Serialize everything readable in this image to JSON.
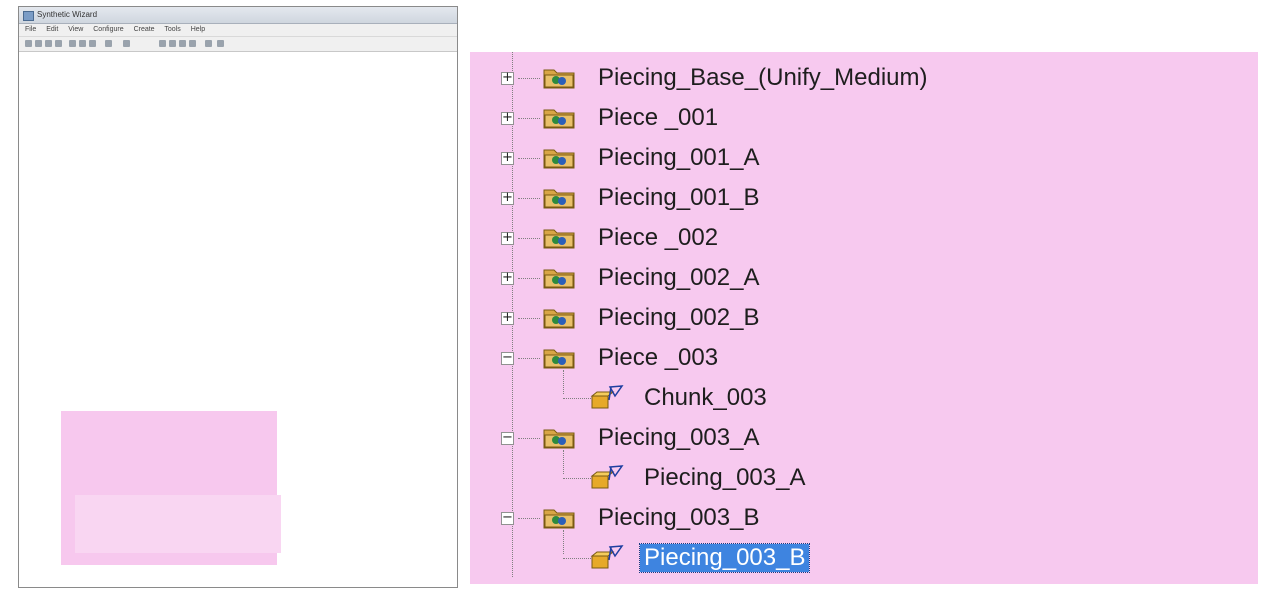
{
  "left_window": {
    "title": "Synthetic Wizard",
    "menu": [
      "File",
      "Edit",
      "View",
      "Configure",
      "Create",
      "Tools",
      "Help"
    ]
  },
  "tree": {
    "items": [
      {
        "label": "Piecing_Base_(Unify_Medium)",
        "state": "collapsed",
        "icon": "folder-icon"
      },
      {
        "label": "Piece _001",
        "state": "collapsed",
        "icon": "folder-icon"
      },
      {
        "label": "Piecing_001_A",
        "state": "collapsed",
        "icon": "folder-icon"
      },
      {
        "label": "Piecing_001_B",
        "state": "collapsed",
        "icon": "folder-icon"
      },
      {
        "label": "Piece _002",
        "state": "collapsed",
        "icon": "folder-icon"
      },
      {
        "label": "Piecing_002_A",
        "state": "collapsed",
        "icon": "folder-icon"
      },
      {
        "label": "Piecing_002_B",
        "state": "collapsed",
        "icon": "folder-icon"
      },
      {
        "label": "Piece _003",
        "state": "expanded",
        "icon": "folder-icon"
      },
      {
        "label": "Chunk_003",
        "state": "leaf",
        "icon": "chunk-icon"
      },
      {
        "label": "Piecing_003_A",
        "state": "expanded",
        "icon": "folder-icon"
      },
      {
        "label": "Piecing_003_A",
        "state": "leaf",
        "icon": "chunk-icon"
      },
      {
        "label": "Piecing_003_B",
        "state": "expanded",
        "icon": "folder-icon"
      },
      {
        "label": "Piecing_003_B",
        "state": "leaf",
        "icon": "chunk-icon",
        "selected": true
      }
    ],
    "plus_glyph": "+",
    "minus_glyph": "−"
  },
  "colors": {
    "highlight_background": "#f7c9ef",
    "selection": "#3e84e0",
    "folder": "#d9a646"
  }
}
